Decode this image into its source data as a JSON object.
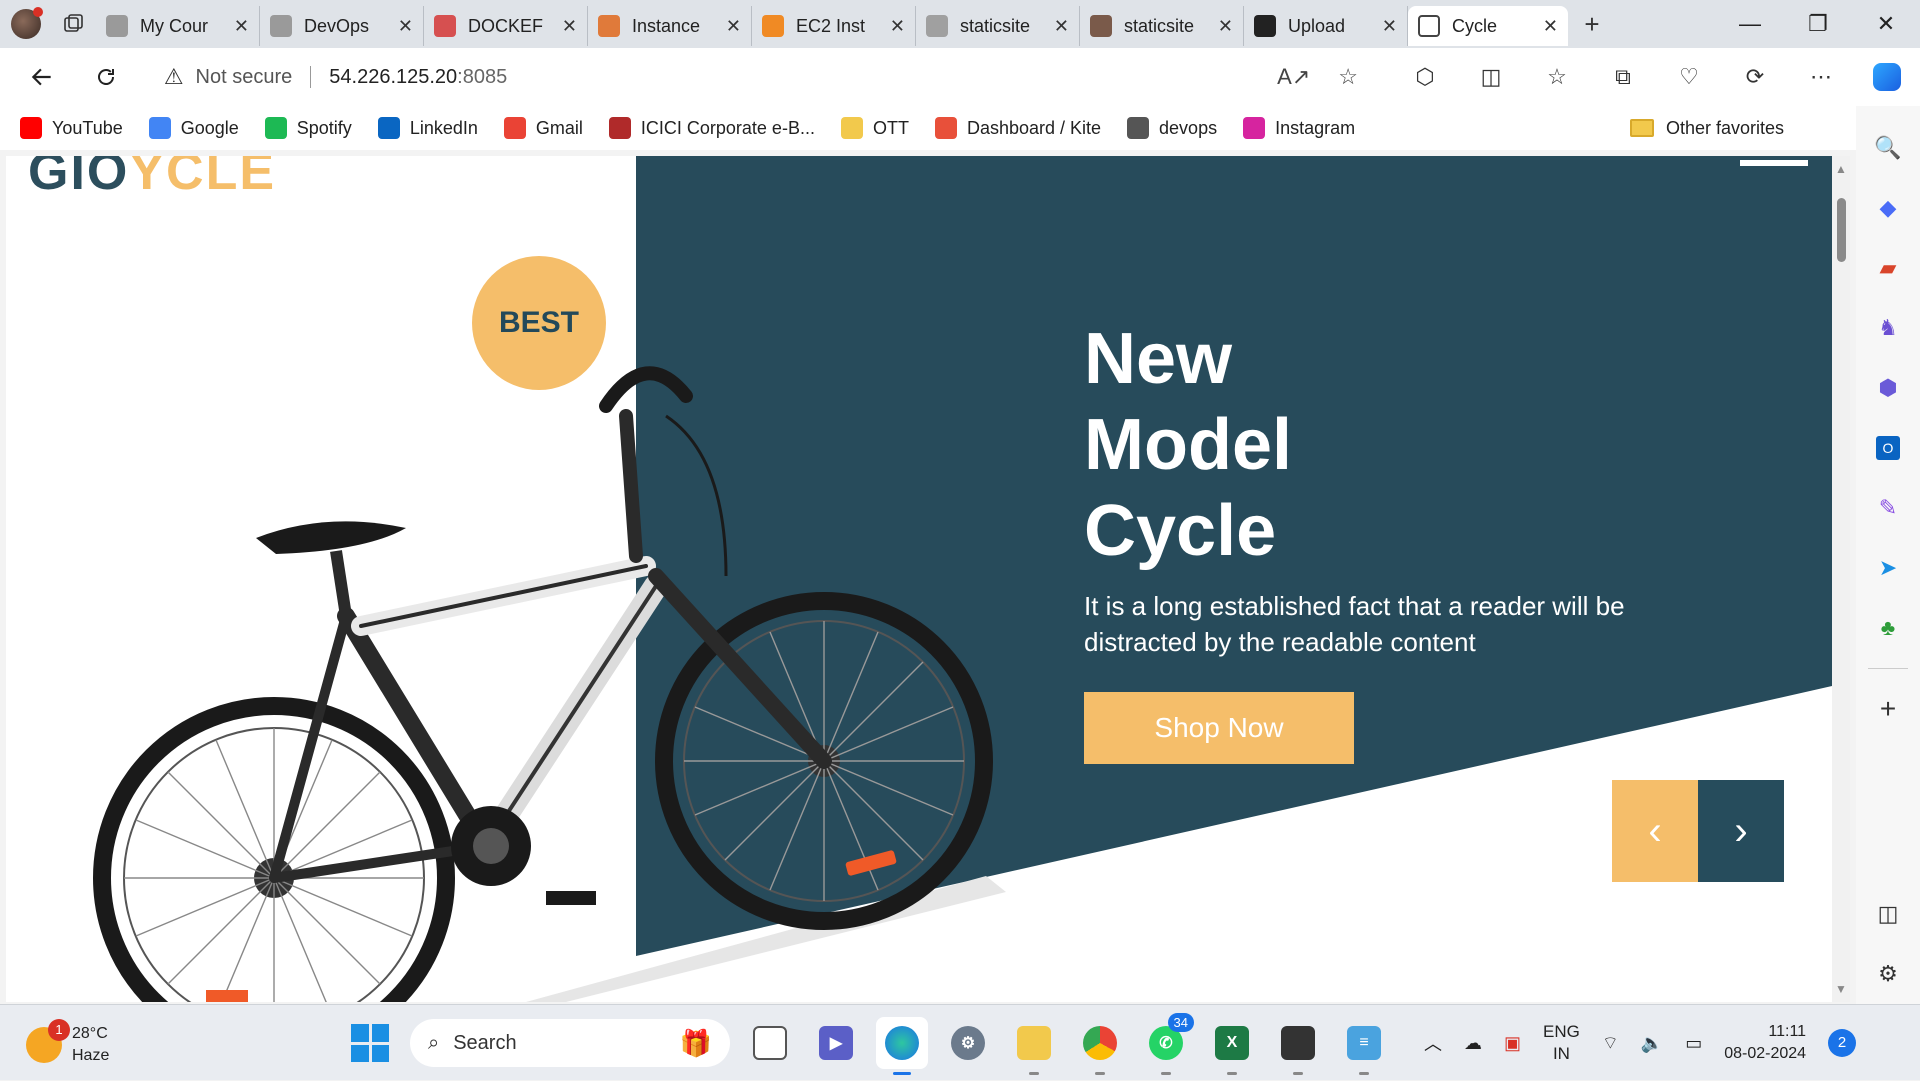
{
  "browser": {
    "tabs": [
      {
        "title": "My Cour",
        "icon": "avatar-icon",
        "color": "#9a9a9a"
      },
      {
        "title": "DevOps",
        "icon": "avatar-icon",
        "color": "#9a9a9a"
      },
      {
        "title": "DOCKEF",
        "icon": "pdf-icon",
        "color": "#d65050"
      },
      {
        "title": "Instance",
        "icon": "aws-icon",
        "color": "#e07a3a"
      },
      {
        "title": "EC2 Inst",
        "icon": "cube-icon",
        "color": "#f08a24"
      },
      {
        "title": "staticsite",
        "icon": "avatar-icon",
        "color": "#a0a0a0"
      },
      {
        "title": "staticsite",
        "icon": "jenkins-icon",
        "color": "#7a5a4a"
      },
      {
        "title": "Upload",
        "icon": "github-icon",
        "color": "#222222"
      },
      {
        "title": "Cycle",
        "icon": "page-icon",
        "color": "#ffffff",
        "active": true
      }
    ],
    "address": {
      "warning": "Not secure",
      "host": "54.226.125.20",
      "port": ":8085"
    },
    "bookmarks": [
      {
        "label": "YouTube",
        "color": "#ff0000"
      },
      {
        "label": "Google",
        "color": "#4285f4"
      },
      {
        "label": "Spotify",
        "color": "#1db954"
      },
      {
        "label": "LinkedIn",
        "color": "#0a66c2"
      },
      {
        "label": "Gmail",
        "color": "#ea4335"
      },
      {
        "label": "ICICI Corporate e-B...",
        "color": "#b02a2a"
      },
      {
        "label": "OTT",
        "color": "#f2c94c"
      },
      {
        "label": "Dashboard / Kite",
        "color": "#e8503a"
      },
      {
        "label": "devops",
        "color": "#555555"
      },
      {
        "label": "Instagram",
        "color": "#d6249f"
      }
    ],
    "other_favorites": "Other favorites"
  },
  "page": {
    "logo_dark": "GIO",
    "logo_light": "YCLE",
    "badge": "BEST",
    "headline": [
      "New",
      "Model",
      "Cycle"
    ],
    "subtext": "It is a long established fact that a reader will be distracted by the readable content",
    "shop_button": "Shop Now",
    "prev_glyph": "‹",
    "next_glyph": "›",
    "colors": {
      "dark": "#274b5b",
      "accent": "#f5be6a"
    }
  },
  "taskbar": {
    "weather_temp": "28°C",
    "weather_desc": "Haze",
    "weather_badge": "1",
    "search_label": "Search",
    "whatsapp_count": "34",
    "lang_top": "ENG",
    "lang_bottom": "IN",
    "time": "11:11",
    "date": "08-02-2024",
    "notifications": "2"
  }
}
